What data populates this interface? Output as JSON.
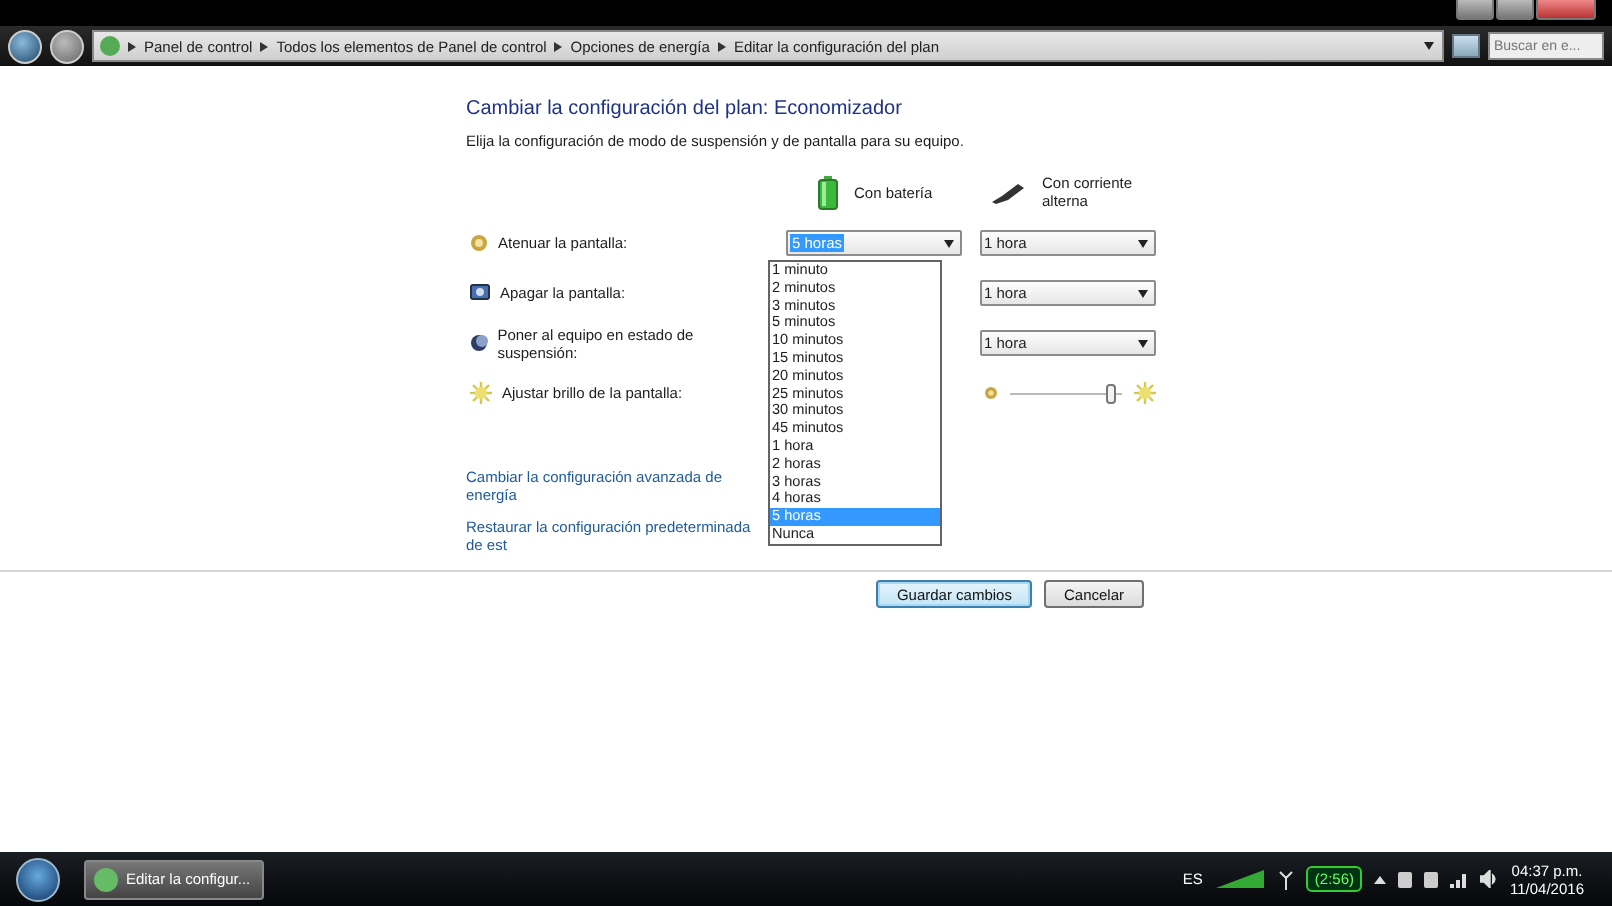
{
  "address_bar": {
    "breadcrumbs": [
      "Panel de control",
      "Todos los elementos de Panel de control",
      "Opciones de energía",
      "Editar la configuración del plan"
    ],
    "search": {
      "placeholder": "Buscar en e..."
    }
  },
  "page": {
    "title": "Cambiar la configuración del plan: Economizador",
    "subtitle": "Elija la configuración de modo de suspensión y de pantalla para su equipo.",
    "columns": [
      {
        "label": "Con batería"
      },
      {
        "label": "Con corriente alterna"
      }
    ],
    "settings": [
      {
        "label": "Atenuar la pantalla:",
        "kind": "dropdown",
        "battery": {
          "value": "5 horas",
          "expanded": true,
          "options": [
            {
              "label": "1 minuto",
              "selected": false
            },
            {
              "label": "2 minutos",
              "selected": false
            },
            {
              "label": "3 minutos",
              "selected": false
            },
            {
              "label": "5 minutos",
              "selected": false
            },
            {
              "label": "10 minutos",
              "selected": false
            },
            {
              "label": "15 minutos",
              "selected": false
            },
            {
              "label": "20 minutos",
              "selected": false
            },
            {
              "label": "25 minutos",
              "selected": false
            },
            {
              "label": "30 minutos",
              "selected": false
            },
            {
              "label": "45 minutos",
              "selected": false
            },
            {
              "label": "1 hora",
              "selected": false
            },
            {
              "label": "2 horas",
              "selected": false
            },
            {
              "label": "3 horas",
              "selected": false
            },
            {
              "label": "4 horas",
              "selected": false
            },
            {
              "label": "5 horas",
              "selected": true
            },
            {
              "label": "Nunca",
              "selected": false
            }
          ]
        },
        "ac": {
          "value": "1 hora"
        }
      },
      {
        "label": "Apagar la pantalla:",
        "kind": "dropdown",
        "ac": {
          "value": "1 hora"
        }
      },
      {
        "label": "Poner al equipo en estado de suspensión:",
        "kind": "dropdown",
        "ac": {
          "value": "1 hora"
        }
      },
      {
        "label": "Ajustar brillo de la pantalla:",
        "kind": "slider",
        "ac": {
          "level": 0.95
        }
      }
    ],
    "links": [
      "Cambiar la configuración avanzada de energía",
      "Restaurar la configuración predeterminada de est"
    ],
    "buttons": [
      {
        "label": "Guardar cambios",
        "kind": "primary"
      },
      {
        "label": "Cancelar",
        "kind": "normal"
      }
    ]
  },
  "taskbar": {
    "task": "Editar la configur...",
    "language": "ES",
    "battery_time": "(2:56)",
    "time": "04:37 p.m.",
    "date": "11/04/2016"
  }
}
